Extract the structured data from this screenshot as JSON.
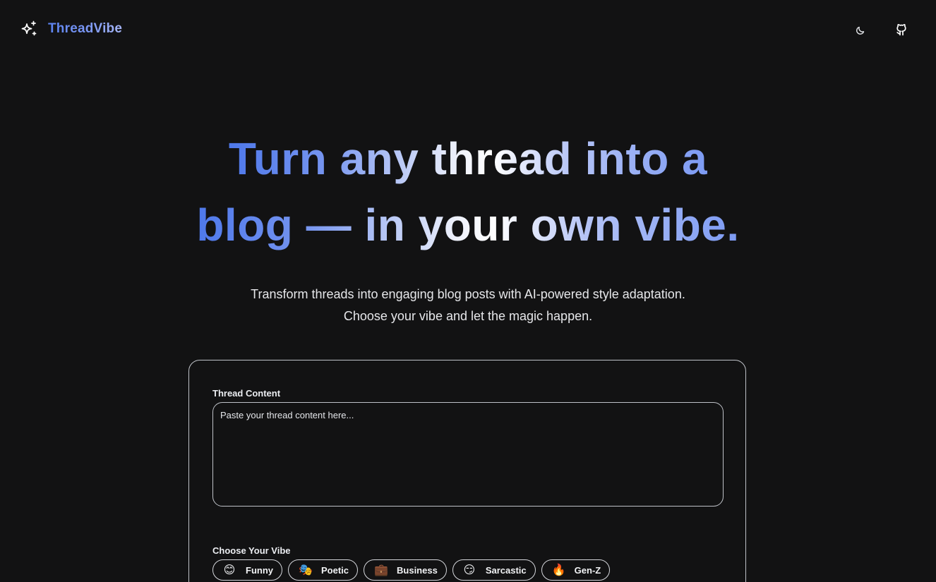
{
  "header": {
    "brand_name": "ThreadVibe",
    "brand_icon": "sparkles-icon",
    "theme_icon": "moon-icon",
    "github_icon": "github-icon"
  },
  "hero": {
    "line1_a": "Turn any thread into a",
    "line2_a": "blog — in your own vibe.",
    "subtitle_line1": "Transform threads into engaging blog posts with AI-powered style adaptation.",
    "subtitle_line2": "Choose your vibe and let the magic happen."
  },
  "form": {
    "thread_label": "Thread Content",
    "thread_placeholder": "Paste your thread content here...",
    "thread_value": "",
    "vibe_label": "Choose Your Vibe",
    "vibes": [
      {
        "emoji": "😊",
        "label": "Funny"
      },
      {
        "emoji": "🎭",
        "label": "Poetic"
      },
      {
        "emoji": "💼",
        "label": "Business"
      },
      {
        "emoji": "😏",
        "label": "Sarcastic"
      },
      {
        "emoji": "🔥",
        "label": "Gen-Z"
      }
    ]
  },
  "colors": {
    "background": "#121213",
    "accent_blue": "#5b82f0",
    "accent_light": "#a7b7f8",
    "border": "#bfc2c8"
  }
}
